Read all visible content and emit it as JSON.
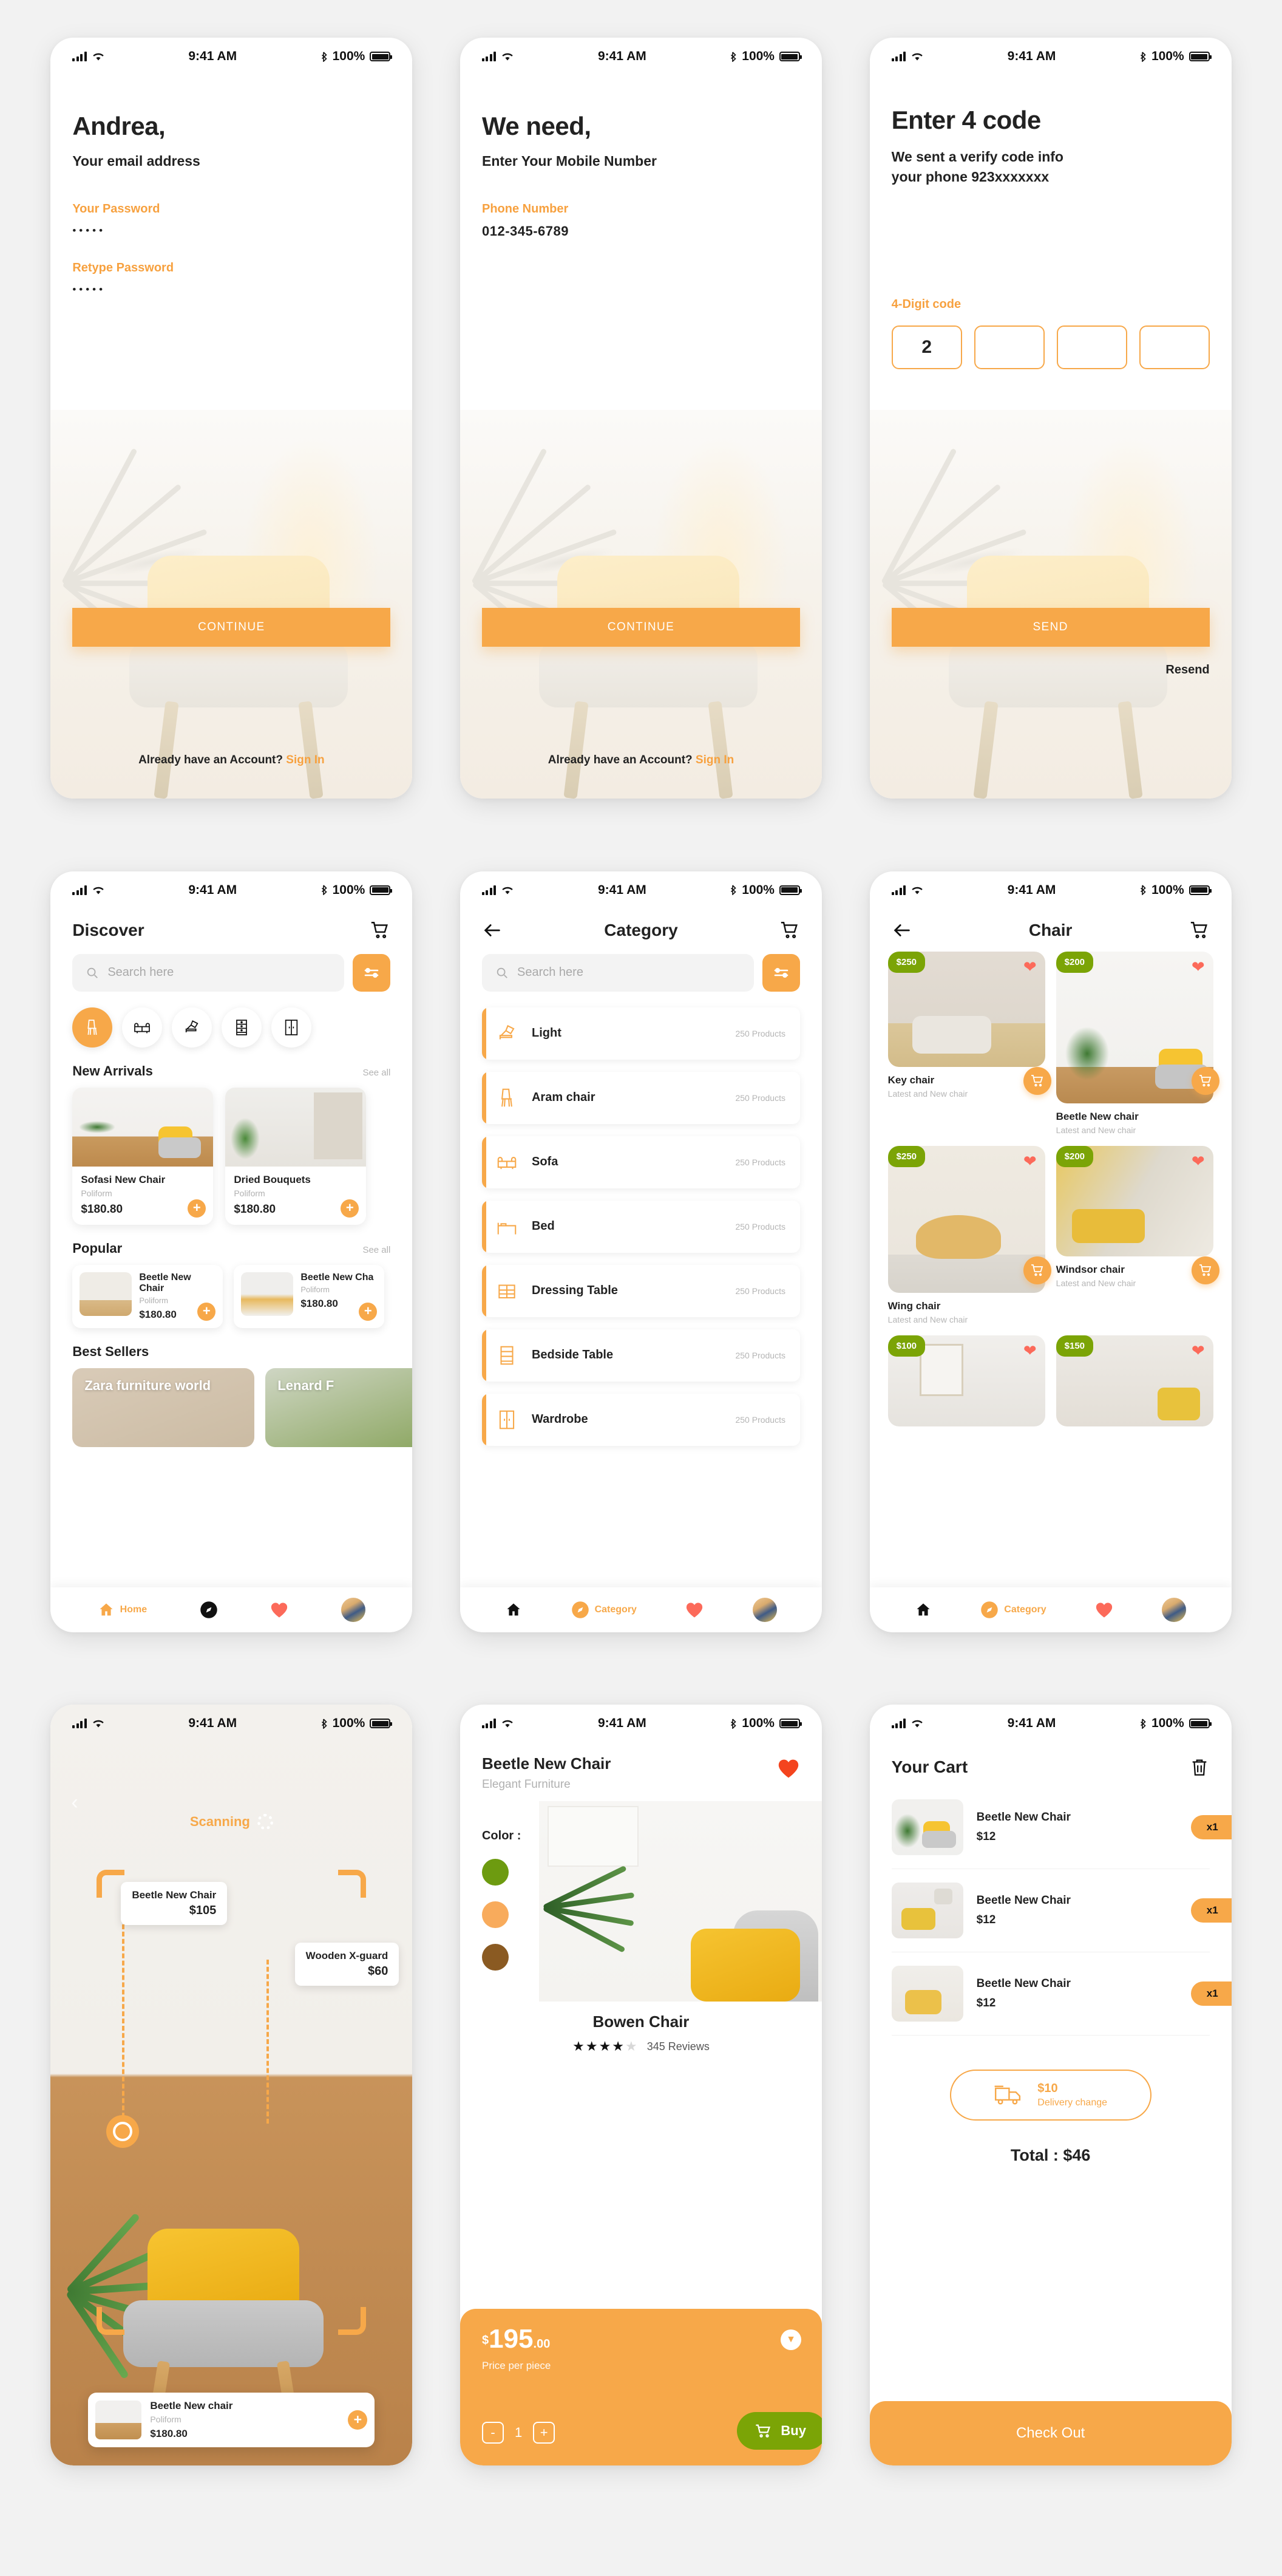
{
  "status_bar": {
    "time": "9:41 AM",
    "battery": "100%"
  },
  "brand": {
    "accent": "#f7a849",
    "green": "#7ba406",
    "heart": "#fc6a5a"
  },
  "screen_signup": {
    "title": "Andrea,",
    "subtitle": "Your email address",
    "password_label": "Your Password",
    "password_value": "•••••",
    "retype_label": "Retype Password",
    "retype_value": "•••••",
    "cta": "CONTINUE",
    "foot_text": "Already have an Account? ",
    "foot_link": "Sign In"
  },
  "screen_phone": {
    "title": "We need,",
    "subtitle": "Enter Your Mobile Number",
    "phone_label": "Phone Number",
    "phone_value": "012-345-6789",
    "cta": "CONTINUE",
    "foot_text": "Already have an Account? ",
    "foot_link": "Sign In"
  },
  "screen_otp": {
    "title": "Enter 4 code",
    "subtitle_line1": "We sent  a verify code info",
    "subtitle_line2": "your phone 923xxxxxxx",
    "code_label": "4-Digit code",
    "digits": [
      "2",
      "",
      "",
      ""
    ],
    "cta": "SEND",
    "resend": "Resend"
  },
  "screen_discover": {
    "title": "Discover",
    "cart_icon": "cart-icon",
    "search_placeholder": "Search here",
    "filter_icon": "sliders-icon",
    "categories": [
      {
        "icon": "chair-icon",
        "active": true
      },
      {
        "icon": "sofa-icon",
        "active": false
      },
      {
        "icon": "lamp-icon",
        "active": false
      },
      {
        "icon": "shelf-icon",
        "active": false
      },
      {
        "icon": "wardrobe-icon",
        "active": false
      }
    ],
    "new_arrivals": {
      "heading": "New Arrivals",
      "see_all": "See all",
      "items": [
        {
          "name": "Sofasi New Chair",
          "brand": "Poliform",
          "price": "$180.80"
        },
        {
          "name": "Dried Bouquets",
          "brand": "Poliform",
          "price": "$180.80"
        }
      ]
    },
    "popular": {
      "heading": "Popular",
      "see_all": "See all",
      "items": [
        {
          "name": "Beetle New Chair",
          "brand": "Poliform",
          "price": "$180.80"
        },
        {
          "name": "Beetle New Cha",
          "brand": "Poliform",
          "price": "$180.80"
        }
      ]
    },
    "best_sellers": {
      "heading": "Best Sellers",
      "items": [
        {
          "name": "Zara furniture world"
        },
        {
          "name": "Lenard F"
        }
      ]
    },
    "tabs": [
      {
        "label": "Home",
        "icon": "home-icon",
        "active": true
      },
      {
        "label": "",
        "icon": "compass-icon",
        "active": false
      },
      {
        "label": "",
        "icon": "heart-icon",
        "active": false
      },
      {
        "label": "",
        "icon": "avatar",
        "active": false
      }
    ]
  },
  "screen_category": {
    "back_icon": "arrow-left-icon",
    "title": "Category",
    "cart_icon": "cart-icon",
    "search_placeholder": "Search here",
    "filter_icon": "sliders-icon",
    "rows": [
      {
        "name": "Light",
        "count": "250 Products",
        "icon": "lamp-icon"
      },
      {
        "name": "Aram chair",
        "count": "250 Products",
        "icon": "chair-icon"
      },
      {
        "name": "Sofa",
        "count": "250 Products",
        "icon": "sofa-icon"
      },
      {
        "name": "Bed",
        "count": "250 Products",
        "icon": "bed-icon"
      },
      {
        "name": "Dressing Table",
        "count": "250 Products",
        "icon": "dresser-icon"
      },
      {
        "name": "Bedside Table",
        "count": "250 Products",
        "icon": "shelf-icon"
      },
      {
        "name": "Wardrobe",
        "count": "250 Products",
        "icon": "wardrobe-icon"
      }
    ],
    "tabs": [
      {
        "label": "",
        "icon": "home-icon",
        "active": false
      },
      {
        "label": "Category",
        "icon": "compass-icon",
        "active": true
      },
      {
        "label": "",
        "icon": "heart-icon",
        "active": false
      },
      {
        "label": "",
        "icon": "avatar",
        "active": false
      }
    ]
  },
  "screen_chair": {
    "back_icon": "arrow-left-icon",
    "title": "Chair",
    "cart_icon": "cart-icon",
    "products": [
      {
        "name": "Key chair",
        "sub": "Latest and New chair",
        "price": "$250"
      },
      {
        "name": "Beetle New chair",
        "sub": "Latest and New chair",
        "price": "$200"
      },
      {
        "name": "Wing chair",
        "sub": "Latest and New chair",
        "price": "$250"
      },
      {
        "name": "Windsor chair",
        "sub": "Latest and New chair",
        "price": "$200"
      },
      {
        "name": "",
        "sub": "",
        "price": "$100"
      },
      {
        "name": "",
        "sub": "",
        "price": "$150"
      }
    ],
    "tabs": [
      {
        "label": "",
        "icon": "home-icon",
        "active": false
      },
      {
        "label": "Category",
        "icon": "compass-icon",
        "active": true
      },
      {
        "label": "",
        "icon": "heart-icon",
        "active": false
      },
      {
        "label": "",
        "icon": "avatar",
        "active": false
      }
    ]
  },
  "screen_ar": {
    "back_icon": "chevron-left-icon",
    "scanning_label": "Scanning",
    "tags": [
      {
        "name": "Beetle New Chair",
        "price": "$105"
      },
      {
        "name": "Wooden X-guard",
        "price": "$60"
      }
    ],
    "card": {
      "name": "Beetle New chair",
      "brand": "Poliform",
      "price": "$180.80"
    }
  },
  "screen_product": {
    "name": "Beetle New Chair",
    "sub": "Elegant Furniture",
    "favorite_icon": "heart-icon",
    "color_label": "Color :",
    "swatches": [
      "#6d9b10",
      "#f8ab5c",
      "#8a5a22"
    ],
    "product_name": "Bowen Chair",
    "rating": 4,
    "rating_max": 5,
    "reviews": "345 Reviews",
    "price_currency": "$",
    "price_main": "195",
    "price_cents": ".00",
    "price_note": "Price per piece",
    "quantity": "1",
    "minus_label": "-",
    "plus_label": "+",
    "buy_label": "Buy",
    "chevron_icon": "chevron-down-icon"
  },
  "screen_cart": {
    "title": "Your Cart",
    "delete_icon": "trash-icon",
    "items": [
      {
        "name": "Beetle New Chair",
        "price": "$12",
        "qty": "x1"
      },
      {
        "name": "Beetle New Chair",
        "price": "$12",
        "qty": "x1"
      },
      {
        "name": "Beetle New Chair",
        "price": "$12",
        "qty": "x1"
      }
    ],
    "delivery_price": "$10",
    "delivery_label": "Delivery change",
    "delivery_icon": "truck-icon",
    "total": "Total : $46",
    "checkout": "Check Out"
  }
}
